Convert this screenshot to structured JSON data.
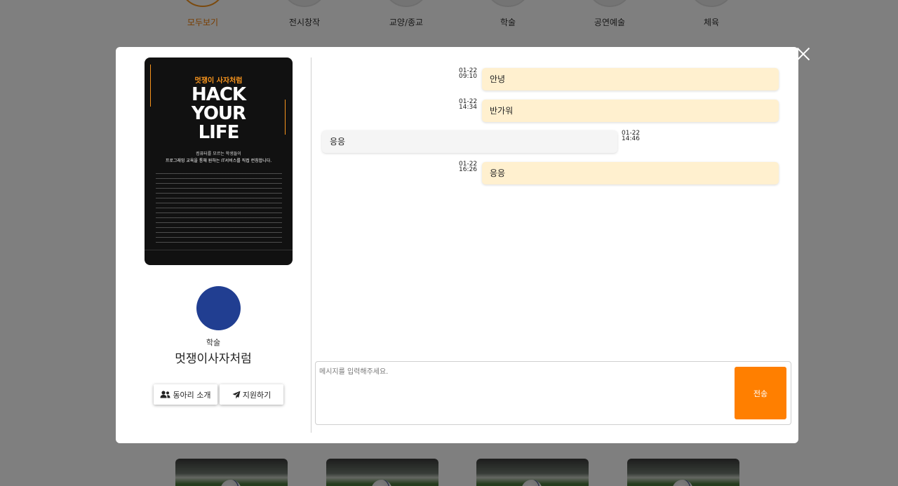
{
  "categories": [
    {
      "label": "모두보기",
      "active": true
    },
    {
      "label": "전시창작",
      "active": false
    },
    {
      "label": "교양/종교",
      "active": false
    },
    {
      "label": "학술",
      "active": false
    },
    {
      "label": "공연예술",
      "active": false
    },
    {
      "label": "체육",
      "active": false
    }
  ],
  "club": {
    "category": "학술",
    "name": "멋쟁이사자처럼",
    "avatar_color": "#213e91",
    "poster": {
      "subtitle": "멋쟁이 사자처럼",
      "title_lines": [
        "HACK",
        "YOUR",
        "LIFE"
      ],
      "desc_line1": "컴퓨터를 모르는 학생들이",
      "desc_line2": "프로그래밍 교육을 통해 원하는 IT서비스를 직접 런칭합니다."
    }
  },
  "buttons": {
    "intro_label": "동아리 소개",
    "apply_label": "지원하기"
  },
  "messages": [
    {
      "from": "me",
      "text": "안녕",
      "date": "01-22",
      "time": "09:10"
    },
    {
      "from": "me",
      "text": "반가워",
      "date": "01-22",
      "time": "14:34"
    },
    {
      "from": "other",
      "text": "응응",
      "date": "01-22",
      "time": "14:46"
    },
    {
      "from": "me",
      "text": "응응",
      "date": "01-22",
      "time": "16:26"
    }
  ],
  "composer": {
    "placeholder": "메시지를 입력해주세요.",
    "send_label": "전송"
  },
  "colors": {
    "accent": "#ff7f00",
    "my_bubble": "#fff0cf",
    "other_bubble": "#f5f5f5"
  }
}
